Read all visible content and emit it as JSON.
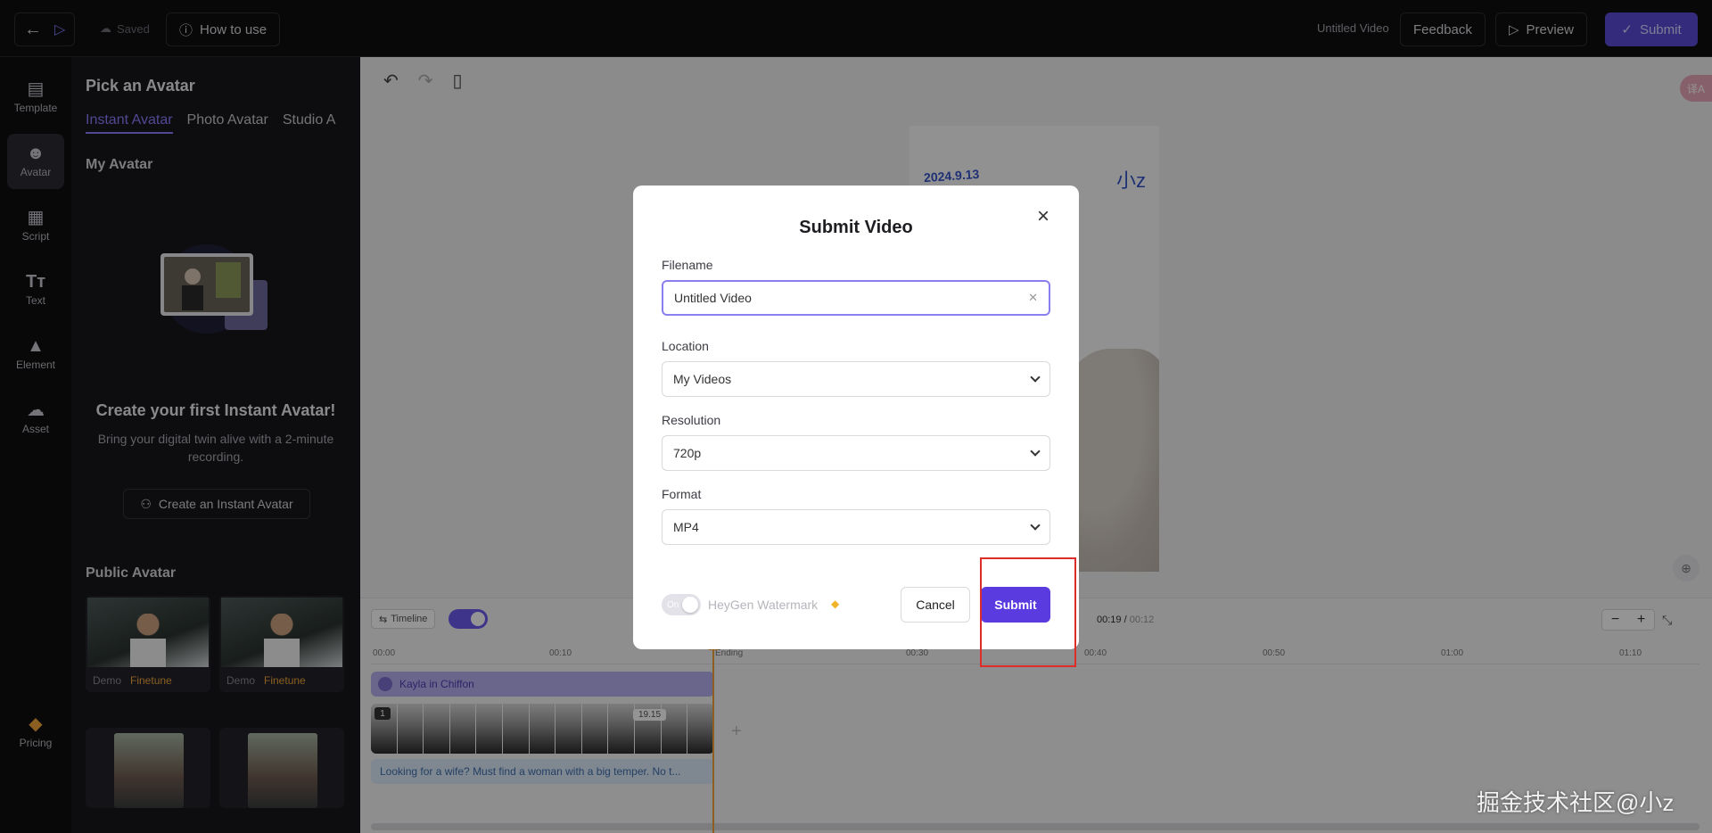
{
  "topbar": {
    "saved_label": "Saved",
    "how_to_use": "How to use",
    "doc_title": "Untitled Video",
    "feedback": "Feedback",
    "preview": "Preview",
    "submit": "Submit"
  },
  "rail": {
    "items": [
      {
        "label": "Template",
        "icon": "template-icon"
      },
      {
        "label": "Avatar",
        "icon": "avatar-icon"
      },
      {
        "label": "Script",
        "icon": "script-icon"
      },
      {
        "label": "Text",
        "icon": "text-icon"
      },
      {
        "label": "Element",
        "icon": "element-icon"
      },
      {
        "label": "Asset",
        "icon": "cloud-upload-icon"
      },
      {
        "label": "Pricing",
        "icon": "gem-icon"
      }
    ]
  },
  "panel": {
    "title": "Pick an Avatar",
    "tabs": [
      "Instant Avatar",
      "Photo Avatar",
      "Studio A"
    ],
    "my_avatar": "My Avatar",
    "first_title": "Create your first Instant Avatar!",
    "first_sub": "Bring your digital twin alive with a 2-minute recording.",
    "create_button": "Create an Instant Avatar",
    "public_avatar": "Public Avatar",
    "cards": [
      {
        "demo": "Demo",
        "tag": "Finetune"
      },
      {
        "demo": "Demo",
        "tag": "Finetune"
      }
    ]
  },
  "canvas": {
    "date_text": "2024.9.13",
    "mark_text": "小z",
    "translate_badge": "译A"
  },
  "timeline": {
    "timeline_label": "Timeline",
    "time_current": "00:19",
    "time_total": "00:12",
    "ruler": [
      "00:00",
      "00:10",
      "Ending",
      "00:30",
      "00:40",
      "00:50",
      "01:00",
      "01:10"
    ],
    "avatar_track": "Kayla in Chiffon",
    "frame_badge": "1",
    "frame_duration": "19.15",
    "script_text": "Looking for a wife? Must find a woman with a big temper. No t..."
  },
  "modal": {
    "title": "Submit Video",
    "filename_label": "Filename",
    "filename_value": "Untitled Video",
    "location_label": "Location",
    "location_value": "My Videos",
    "resolution_label": "Resolution",
    "resolution_value": "720p",
    "format_label": "Format",
    "format_value": "MP4",
    "watermark_toggle": "On",
    "watermark_label": "HeyGen Watermark",
    "cancel": "Cancel",
    "submit": "Submit"
  },
  "watermark": "掘金技术社区@小z"
}
